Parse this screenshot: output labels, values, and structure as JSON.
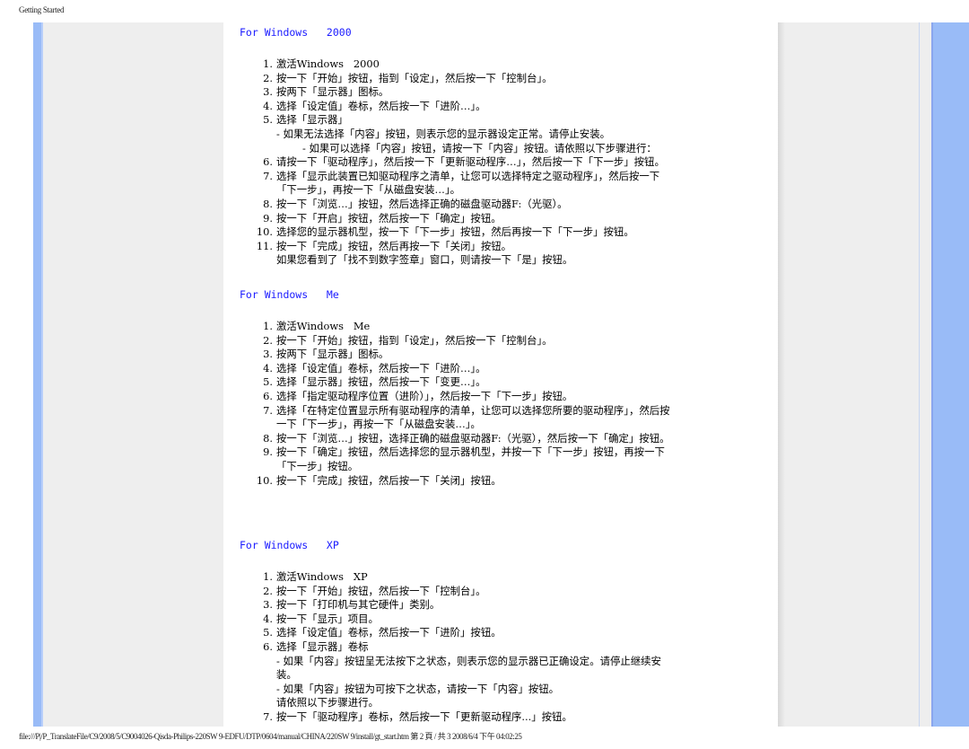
{
  "header": {
    "title": "Getting Started"
  },
  "sections": [
    {
      "title": "For Windows   2000",
      "steps": [
        {
          "num": "1.",
          "text": "激活Windows   2000"
        },
        {
          "num": "2.",
          "text": "按一下「开始」按钮，指到「设定」，然后按一下「控制台」。"
        },
        {
          "num": "3.",
          "text": "按两下「显示器」图标。"
        },
        {
          "num": "4.",
          "text": "选择「设定值」卷标，然后按一下「进阶…」。"
        },
        {
          "num": "5.",
          "text": "选择「显示器」"
        }
      ],
      "notes_after_5": [
        "- 如果无法选择「内容」按钮，则表示您的显示器设定正常。请停止安装。",
        "- 如果可以选择「内容」按钮，请按一下「内容」按钮。请依照以下步骤进行："
      ],
      "steps_cont": [
        {
          "num": "6.",
          "text": "请按一下「驱动程序」，然后按一下「更新驱动程序…」，然后按一下「下一步」按钮。"
        },
        {
          "num": "7.",
          "text": "选择「显示此装置已知驱动程序之清单，让您可以选择特定之驱动程序」，然后按一下\n「下一步」，再按一下「从磁盘安装…」。"
        },
        {
          "num": "8.",
          "text": "按一下「浏览…」按钮，然后选择正确的磁盘驱动器F:（光驱）。"
        },
        {
          "num": "9.",
          "text": "按一下「开启」按钮，然后按一下「确定」按钮。"
        },
        {
          "num": "10.",
          "text": "选择您的显示器机型，按一下「下一步」按钮，然后再按一下「下一步」按钮。"
        },
        {
          "num": "11.",
          "text": "按一下「完成」按钮，然后再按一下「关闭」按钮。"
        }
      ],
      "final_note": "如果您看到了「找不到数字签章」窗口，则请按一下「是」按钮。"
    },
    {
      "title": "For Windows   Me",
      "steps": [
        {
          "num": "1.",
          "text": "激活Windows   Me"
        },
        {
          "num": "2.",
          "text": "按一下「开始」按钮，指到「设定」，然后按一下「控制台」。"
        },
        {
          "num": "3.",
          "text": "按两下「显示器」图标。"
        },
        {
          "num": "4.",
          "text": "选择「设定值」卷标，然后按一下「进阶…」。"
        },
        {
          "num": "5.",
          "text": "选择「显示器」按钮，然后按一下「变更…」。"
        },
        {
          "num": "6.",
          "text": "选择「指定驱动程序位置（进阶）」，然后按一下「下一步」按钮。"
        },
        {
          "num": "7.",
          "text": "选择「在特定位置显示所有驱动程序的清单，让您可以选择您所要的驱动程序」，然后按\n一下「下一步」，再按一下「从磁盘安装…」。"
        },
        {
          "num": "8.",
          "text": "按一下「浏览…」按钮，选择正确的磁盘驱动器F:（光驱），然后按一下「确定」按钮。"
        },
        {
          "num": "9.",
          "text": "按一下「确定」按钮，然后选择您的显示器机型，并按一下「下一步」按钮，再按一下\n「下一步」按钮。"
        },
        {
          "num": "10.",
          "text": "按一下「完成」按钮，然后按一下「关闭」按钮。"
        }
      ]
    },
    {
      "title": "For Windows   XP",
      "steps": [
        {
          "num": "1.",
          "text": "激活Windows   XP"
        },
        {
          "num": "2.",
          "text": "按一下「开始」按钮，然后按一下「控制台」。"
        },
        {
          "num": "3.",
          "text": "按一下「打印机与其它硬件」类别。"
        },
        {
          "num": "4.",
          "text": "按一下「显示」项目。"
        },
        {
          "num": "5.",
          "text": "选择「设定值」卷标，然后按一下「进阶」按钮。"
        },
        {
          "num": "6.",
          "text": "选择「显示器」卷标"
        }
      ],
      "notes_after_6": [
        "- 如果「内容」按钮呈无法按下之状态，则表示您的显示器已正确设定。请停止继续安\n装。",
        "- 如果「内容」按钮为可按下之状态，请按一下「内容」按钮。",
        "请依照以下步骤进行。"
      ],
      "steps_cont": [
        {
          "num": "7.",
          "text": "按一下「驱动程序」卷标，然后按一下「更新驱动程序...」按钮。"
        }
      ]
    }
  ],
  "footer": {
    "text": "file:///P|/P_TranslateFile/C9/2008/5/C9004026-Qisda-Philips-220SW 9-EDFU/DTP/0604/manual/CHINA/220SW 9/install/gt_start.htm 第 2 頁 / 共 3 2008/6/4 下午 04:02:25"
  },
  "colors": {
    "accent_bar": "#99bbf7",
    "panel": "#eeeeee",
    "section_title": "#1a1aff"
  }
}
